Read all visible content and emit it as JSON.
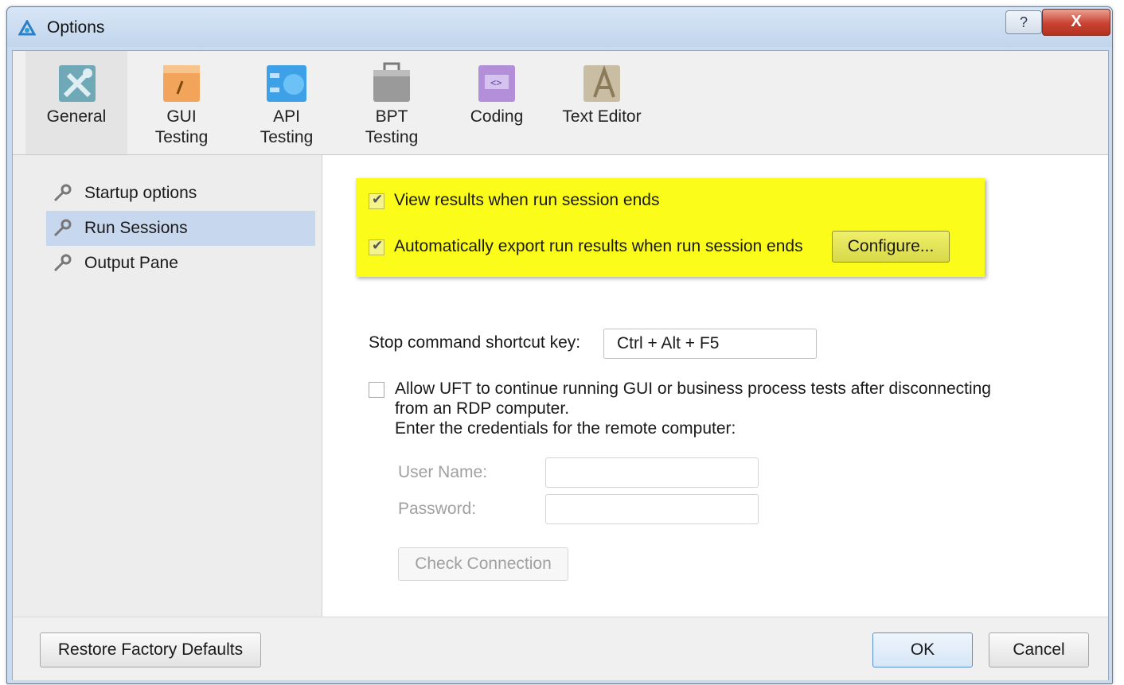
{
  "window": {
    "title": "Options",
    "help_label": "?",
    "close_label": "X"
  },
  "toolbar": {
    "items": [
      {
        "line1": "General",
        "line2": ""
      },
      {
        "line1": "GUI",
        "line2": "Testing"
      },
      {
        "line1": "API",
        "line2": "Testing"
      },
      {
        "line1": "BPT",
        "line2": "Testing"
      },
      {
        "line1": "Coding",
        "line2": ""
      },
      {
        "line1": "Text Editor",
        "line2": ""
      }
    ],
    "selected": "General"
  },
  "sidebar": {
    "items": [
      {
        "label": "Startup options"
      },
      {
        "label": "Run Sessions"
      },
      {
        "label": "Output Pane"
      }
    ],
    "selected": "Run Sessions"
  },
  "run_sessions": {
    "view_results": {
      "label": "View results when run session ends",
      "checked": true
    },
    "auto_export": {
      "label": "Automatically export run results when run session ends",
      "checked": true
    },
    "configure_label": "Configure...",
    "stop_shortcut_label": "Stop command shortcut key:",
    "stop_shortcut_value": "Ctrl + Alt + F5",
    "rdp": {
      "line1": "Allow UFT to continue running GUI or business process tests after disconnecting",
      "line2": "from an RDP computer.",
      "line3": "Enter the credentials for the remote computer:",
      "checked": false
    },
    "user_name_label": "User Name:",
    "user_name_value": "",
    "password_label": "Password:",
    "password_value": "",
    "check_connection_label": "Check Connection"
  },
  "footer": {
    "restore_label": "Restore Factory Defaults",
    "ok_label": "OK",
    "cancel_label": "Cancel"
  },
  "colors": {
    "highlight": "#fcfc1a",
    "selected_side": "#c7d7ee",
    "title_bar": "#c9dbef"
  }
}
